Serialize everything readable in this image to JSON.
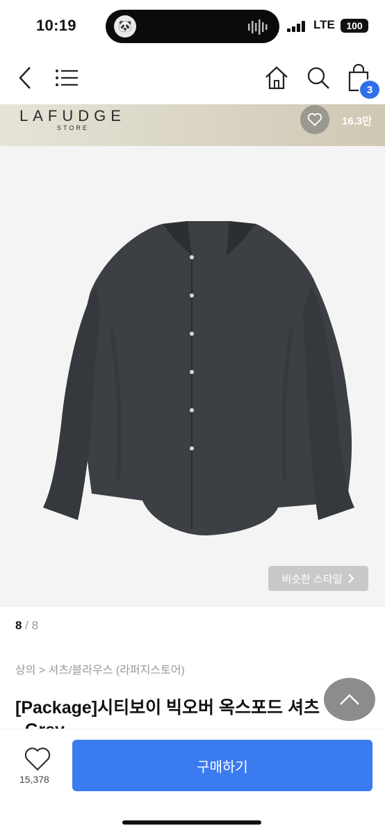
{
  "status_bar": {
    "time": "10:19",
    "network": "LTE",
    "battery": "100"
  },
  "nav": {
    "cart_count": "3"
  },
  "store": {
    "name": "LAFUDGE",
    "sub": "STORE",
    "likes": "16.3만"
  },
  "product": {
    "image_icon": "shirt-image",
    "similar_style_label": "비슷한 스타일",
    "page_current": "8",
    "page_sep": " / ",
    "page_total": "8",
    "breadcrumb": "상의 > 셔츠/블라우스 (라퍼지스토어)",
    "title": "[Package]시티보이 빅오버 옥스포드 셔츠",
    "title_line2": "_Grey"
  },
  "bottom_bar": {
    "like_count": "15,378",
    "buy_label": "구매하기"
  },
  "colors": {
    "accent": "#3a7bef",
    "badge": "#2f6fe8",
    "shirt": "#3c3f43"
  }
}
